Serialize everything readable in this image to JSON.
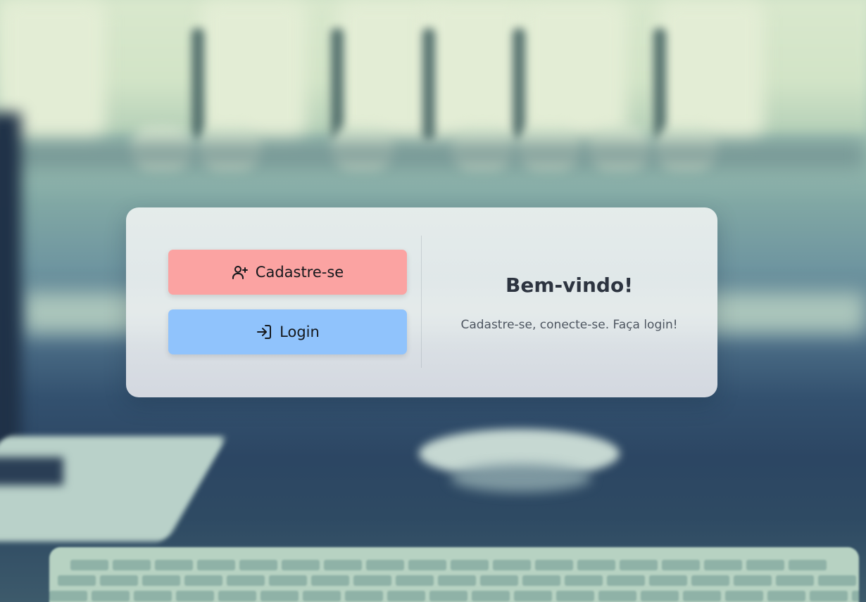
{
  "colors": {
    "register_button": "#fba3a2",
    "login_button": "#90c3fc",
    "title": "#2d3440",
    "subtitle": "#4d5560"
  },
  "auth": {
    "register": {
      "label": "Cadastre-se",
      "icon": "user-plus-icon"
    },
    "login": {
      "label": "Login",
      "icon": "log-in-icon"
    }
  },
  "welcome": {
    "title": "Bem-vindo!",
    "subtitle": "Cadastre-se, conecte-se. Faça login!"
  }
}
